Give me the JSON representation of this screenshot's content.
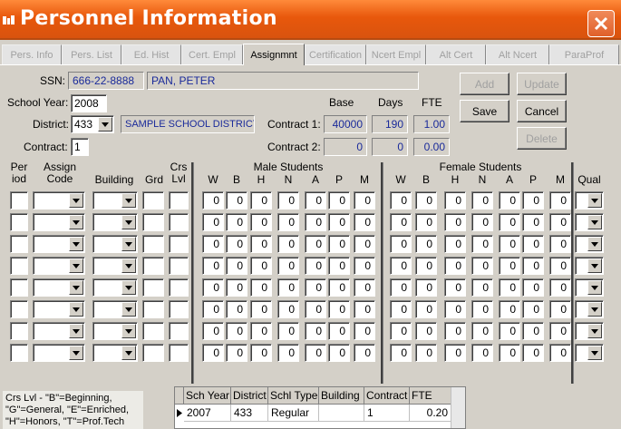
{
  "window": {
    "title": "Personnel Information"
  },
  "tabs": [
    "Pers. Info",
    "Pers. List",
    "Ed. Hist",
    "Cert. Empl",
    "Assignmnt",
    "Certification",
    "Ncert Empl",
    "Alt Cert",
    "Alt Ncert",
    "ParaProf"
  ],
  "form": {
    "ssn_label": "SSN:",
    "ssn": "666-22-8888",
    "name": "PAN, PETER",
    "school_year_label": "School Year:",
    "school_year": "2008",
    "district_label": "District:",
    "district_code": "433",
    "district_name": "SAMPLE SCHOOL DISTRICT",
    "contract_label": "Contract:",
    "contract": "1"
  },
  "contracts": {
    "base_header": "Base",
    "days_header": "Days",
    "fte_header": "FTE",
    "rows": [
      {
        "label": "Contract 1:",
        "base": "40000",
        "days": "190",
        "fte": "1.00"
      },
      {
        "label": "Contract 2:",
        "base": "0",
        "days": "0",
        "fte": "0.00"
      }
    ]
  },
  "buttons": {
    "add": "Add",
    "update": "Update",
    "save": "Save",
    "cancel": "Cancel",
    "delete": "Delete"
  },
  "grid_headers": {
    "period": "Per\niod",
    "assign_code": "Assign\nCode",
    "building": "Building",
    "grade": "Grd",
    "crs_lvl": "Crs\nLvl",
    "male_group": "Male Students",
    "female_group": "Female Students",
    "ethnic": [
      "W",
      "B",
      "H",
      "N",
      "A",
      "P",
      "M"
    ],
    "qual": "Qual"
  },
  "assignment_rows": [
    {
      "male": [
        "0",
        "0",
        "0",
        "0",
        "0",
        "0",
        "0"
      ],
      "female": [
        "0",
        "0",
        "0",
        "0",
        "0",
        "0",
        "0"
      ]
    },
    {
      "male": [
        "0",
        "0",
        "0",
        "0",
        "0",
        "0",
        "0"
      ],
      "female": [
        "0",
        "0",
        "0",
        "0",
        "0",
        "0",
        "0"
      ]
    },
    {
      "male": [
        "0",
        "0",
        "0",
        "0",
        "0",
        "0",
        "0"
      ],
      "female": [
        "0",
        "0",
        "0",
        "0",
        "0",
        "0",
        "0"
      ]
    },
    {
      "male": [
        "0",
        "0",
        "0",
        "0",
        "0",
        "0",
        "0"
      ],
      "female": [
        "0",
        "0",
        "0",
        "0",
        "0",
        "0",
        "0"
      ]
    },
    {
      "male": [
        "0",
        "0",
        "0",
        "0",
        "0",
        "0",
        "0"
      ],
      "female": [
        "0",
        "0",
        "0",
        "0",
        "0",
        "0",
        "0"
      ]
    },
    {
      "male": [
        "0",
        "0",
        "0",
        "0",
        "0",
        "0",
        "0"
      ],
      "female": [
        "0",
        "0",
        "0",
        "0",
        "0",
        "0",
        "0"
      ]
    },
    {
      "male": [
        "0",
        "0",
        "0",
        "0",
        "0",
        "0",
        "0"
      ],
      "female": [
        "0",
        "0",
        "0",
        "0",
        "0",
        "0",
        "0"
      ]
    },
    {
      "male": [
        "0",
        "0",
        "0",
        "0",
        "0",
        "0",
        "0"
      ],
      "female": [
        "0",
        "0",
        "0",
        "0",
        "0",
        "0",
        "0"
      ]
    }
  ],
  "legend": "Crs Lvl - \"B\"=Beginning, \"G\"=General, \"E\"=Enriched, \"H\"=Honors, \"T\"=Prof.Tech",
  "history_table": {
    "columns": [
      "Sch Year",
      "District",
      "Schl Type",
      "Building",
      "Contract",
      "FTE"
    ],
    "rows": [
      [
        "2007",
        "433",
        "Regular",
        "",
        "1",
        "0.20"
      ]
    ]
  },
  "colors": {
    "titlebar": "#e8580c",
    "accent_text": "#1a2a9a"
  },
  "icons": [
    "app-icon",
    "close-icon",
    "dropdown-arrow-icon",
    "row-pointer-icon"
  ]
}
